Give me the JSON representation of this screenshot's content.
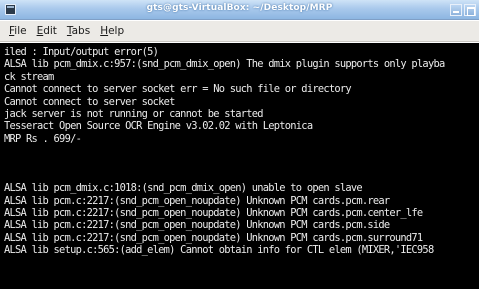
{
  "window": {
    "title": "gts@gts-VirtualBox: ~/Desktop/MRP"
  },
  "menubar": {
    "items": [
      {
        "mnemonic": "F",
        "rest": "ile"
      },
      {
        "mnemonic": "E",
        "rest": "dit"
      },
      {
        "mnemonic": "T",
        "rest": "abs"
      },
      {
        "mnemonic": "H",
        "rest": "elp"
      }
    ]
  },
  "terminal": {
    "lines": [
      "iled : Input/output error(5)",
      "ALSA lib pcm_dmix.c:957:(snd_pcm_dmix_open) The dmix plugin supports only playba",
      "ck stream",
      "Cannot connect to server socket err = No such file or directory",
      "Cannot connect to server socket",
      "jack server is not running or cannot be started",
      "Tesseract Open Source OCR Engine v3.02.02 with Leptonica",
      "MRP Rs . 699/-",
      "",
      "",
      "",
      "ALSA lib pcm_dmix.c:1018:(snd_pcm_dmix_open) unable to open slave",
      "ALSA lib pcm.c:2217:(snd_pcm_open_noupdate) Unknown PCM cards.pcm.rear",
      "ALSA lib pcm.c:2217:(snd_pcm_open_noupdate) Unknown PCM cards.pcm.center_lfe",
      "ALSA lib pcm.c:2217:(snd_pcm_open_noupdate) Unknown PCM cards.pcm.side",
      "ALSA lib pcm.c:2217:(snd_pcm_open_noupdate) Unknown PCM cards.pcm.surround71",
      "ALSA lib setup.c:565:(add_elem) Cannot obtain info for CTL elem (MIXER,'IEC958"
    ]
  },
  "colors": {
    "titlebar": "#a9c9ec",
    "terminal_bg": "#000000",
    "terminal_fg": "#ececec",
    "menubar_bg": "#eceae6"
  }
}
